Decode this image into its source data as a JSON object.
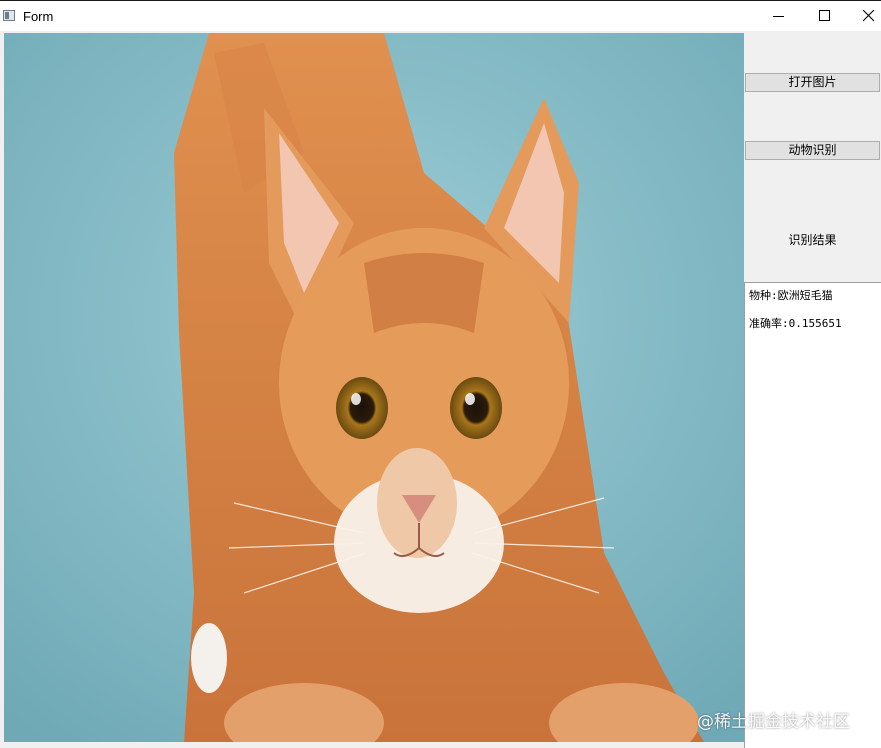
{
  "window": {
    "title": "Form",
    "controls": [
      "minimize-icon",
      "maximize-icon",
      "close-icon"
    ]
  },
  "image": {
    "subject": "cat-photo",
    "background_color": "#87bfca",
    "fur_color": "#d9884a"
  },
  "buttons": {
    "open_image": "打开图片",
    "recognize": "动物识别"
  },
  "result": {
    "heading": "识别结果",
    "species_line": "物种:欧洲短毛猫",
    "accuracy_line": "准确率:0.155651"
  },
  "watermark": "@稀土掘金技术社区"
}
